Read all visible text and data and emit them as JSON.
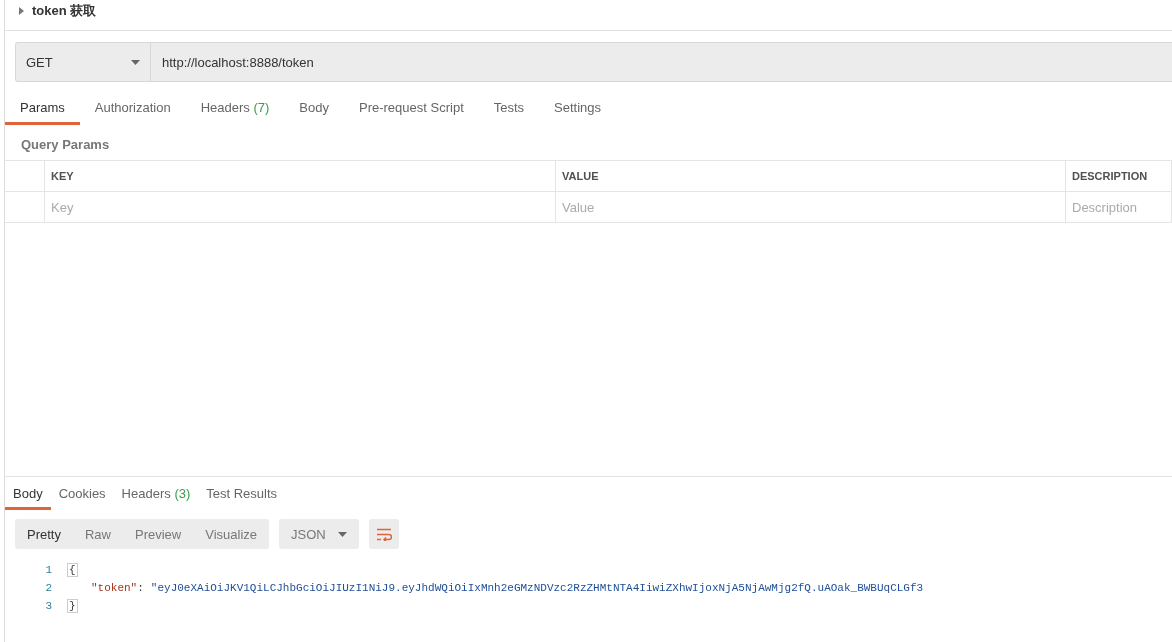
{
  "request": {
    "name": "token 获取",
    "method": "GET",
    "url": "http://localhost:8888/token"
  },
  "request_tabs": [
    {
      "label": "Params",
      "selected": true
    },
    {
      "label": "Authorization",
      "selected": false
    },
    {
      "label": "Headers",
      "count": "(7)",
      "selected": false
    },
    {
      "label": "Body",
      "selected": false
    },
    {
      "label": "Pre-request Script",
      "selected": false
    },
    {
      "label": "Tests",
      "selected": false
    },
    {
      "label": "Settings",
      "selected": false
    }
  ],
  "query_params": {
    "title": "Query Params",
    "columns": [
      "KEY",
      "VALUE",
      "DESCRIPTION"
    ],
    "placeholders": [
      "Key",
      "Value",
      "Description"
    ]
  },
  "response": {
    "tabs": [
      {
        "label": "Body",
        "selected": true
      },
      {
        "label": "Cookies",
        "selected": false
      },
      {
        "label": "Headers",
        "count": "(3)",
        "selected": false
      },
      {
        "label": "Test Results",
        "selected": false
      }
    ],
    "view_modes": [
      {
        "label": "Pretty",
        "selected": true
      },
      {
        "label": "Raw",
        "selected": false
      },
      {
        "label": "Preview",
        "selected": false
      },
      {
        "label": "Visualize",
        "selected": false
      }
    ],
    "format": "JSON",
    "lines": [
      {
        "number": "1",
        "kind": "brace",
        "text": "{"
      },
      {
        "number": "2",
        "kind": "pair",
        "key": "\"token\"",
        "separator": ":",
        "value": "\"eyJ0eXAiOiJKV1QiLCJhbGciOiJIUzI1NiJ9.eyJhdWQiOiIxMnh2eGMzNDVzc2RzZHMtNTA4IiwiZXhwIjoxNjA5NjAwMjg2fQ.uAOak_BWBUqCLGf3"
      },
      {
        "number": "3",
        "kind": "brace",
        "text": "}"
      }
    ]
  }
}
